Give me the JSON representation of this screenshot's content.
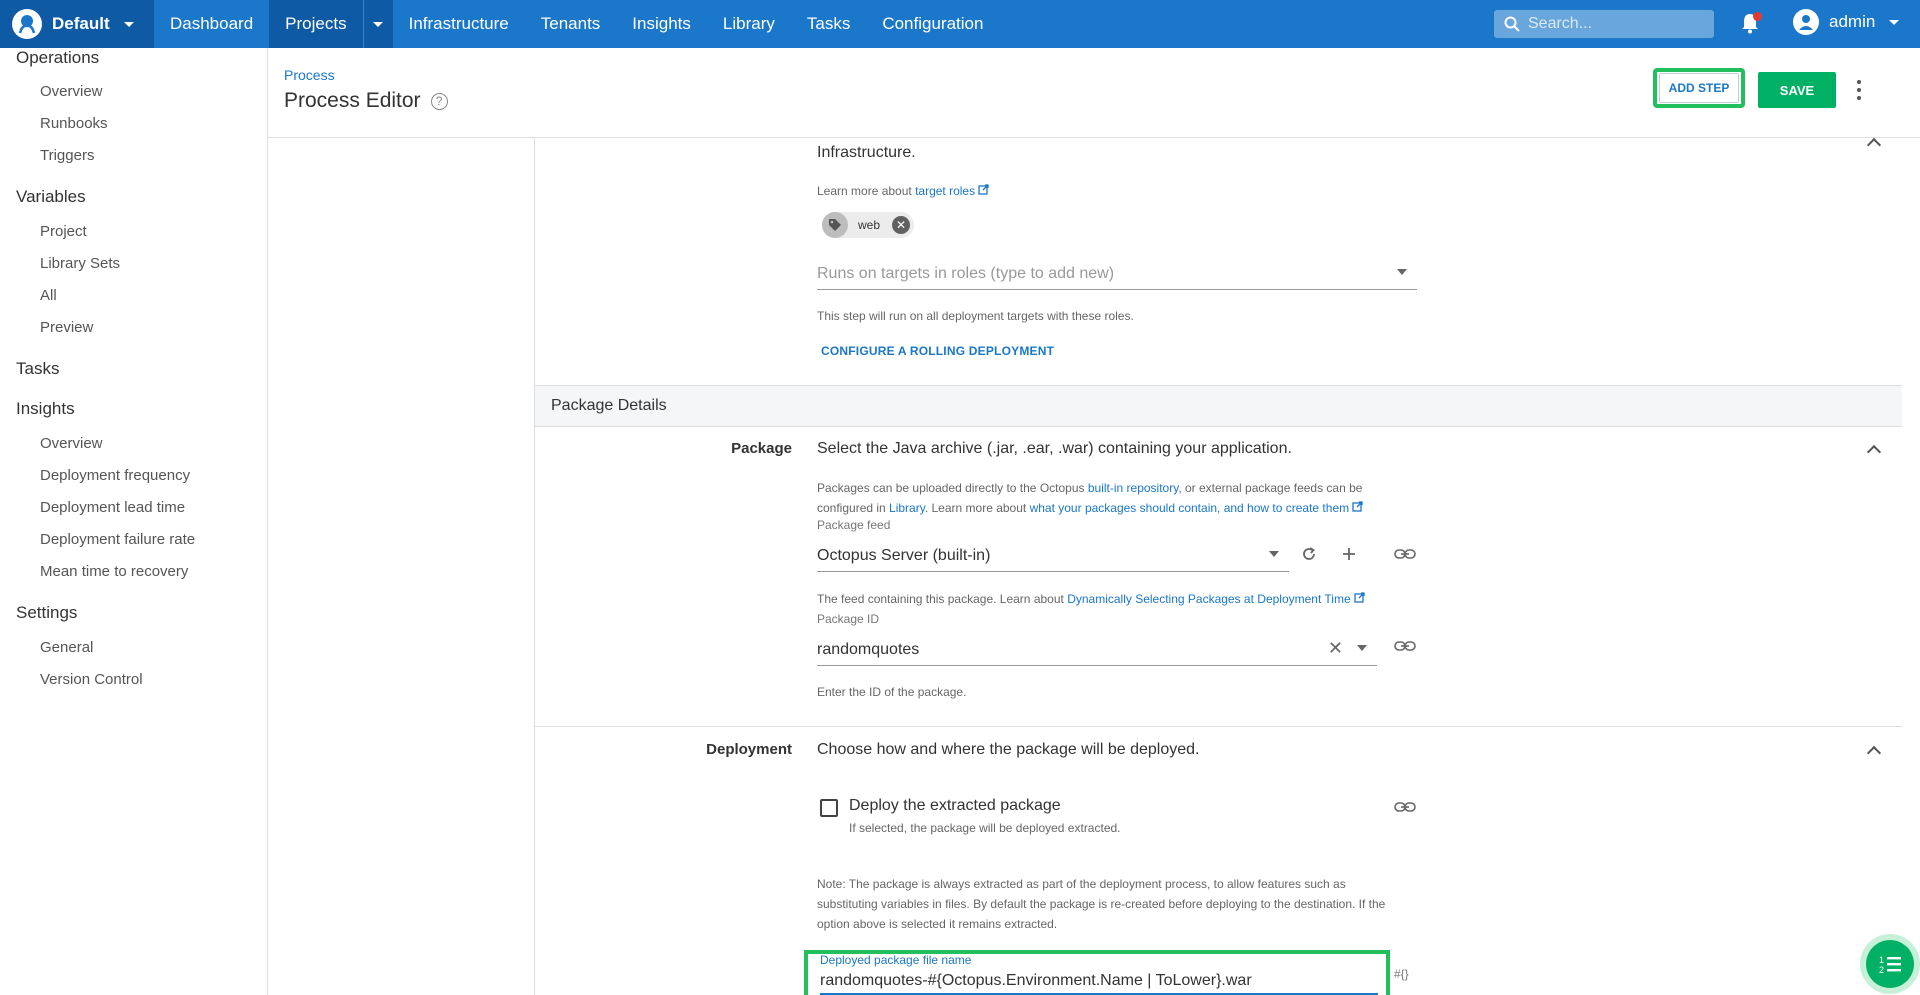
{
  "topnav": {
    "space": "Default",
    "items": [
      "Dashboard",
      "Projects",
      "Infrastructure",
      "Tenants",
      "Insights",
      "Library",
      "Tasks",
      "Configuration"
    ],
    "active": "Projects",
    "search_placeholder": "Search...",
    "user": "admin"
  },
  "sidebar": {
    "groups": [
      {
        "title": "Operations",
        "items": [
          "Overview",
          "Runbooks",
          "Triggers"
        ]
      },
      {
        "title": "Variables",
        "items": [
          "Project",
          "Library Sets",
          "All",
          "Preview"
        ]
      },
      {
        "title": "Tasks",
        "items": []
      },
      {
        "title": "Insights",
        "items": [
          "Overview",
          "Deployment frequency",
          "Deployment lead time",
          "Deployment failure rate",
          "Mean time to recovery"
        ]
      },
      {
        "title": "Settings",
        "items": [
          "General",
          "Version Control"
        ]
      }
    ]
  },
  "header": {
    "breadcrumb": "Process",
    "title": "Process Editor",
    "add_step": "ADD STEP",
    "save": "SAVE"
  },
  "roles": {
    "infra_link": "Infrastructure.",
    "learn_prefix": "Learn more about ",
    "learn_link": "target roles",
    "chip": "web",
    "placeholder": "Runs on targets in roles (type to add new)",
    "help": "This step will run on all deployment targets with these roles.",
    "rolling": "CONFIGURE A ROLLING DEPLOYMENT"
  },
  "package_details": {
    "section_title": "Package Details",
    "label": "Package",
    "description": "Select the Java archive (.jar, .ear, .war) containing your application.",
    "help_1": "Packages can be uploaded directly to the Octopus ",
    "help_link_1": "built-in repository",
    "help_2": ", or external package feeds can be",
    "help_3": "configured in ",
    "help_link_2": "Library",
    "help_4": ". Learn more about ",
    "help_link_3": "what your packages should contain, and how to create them",
    "feed_caption": "Package feed",
    "feed_value": "Octopus Server (built-in)",
    "feed_help": "The feed containing this package. Learn about ",
    "feed_help_link": "Dynamically Selecting Packages at Deployment Time",
    "id_caption": "Package ID",
    "id_value": "randomquotes",
    "id_help": "Enter the ID of the package."
  },
  "deployment": {
    "label": "Deployment",
    "description": "Choose how and where the package will be deployed.",
    "checkbox_label": "Deploy the extracted package",
    "checkbox_help": "If selected, the package will be deployed extracted.",
    "note_1": "Note: The package is always extracted as part of the deployment process, to allow features such as",
    "note_2": "substituting variables in files. By default the package is re-created before deploying to the destination. If the",
    "note_3": "option above is selected it remains extracted.",
    "filename_caption": "Deployed package file name",
    "filename_value": "randomquotes-#{Octopus.Environment.Name | ToLower}.war",
    "var_hint": "#{}"
  }
}
